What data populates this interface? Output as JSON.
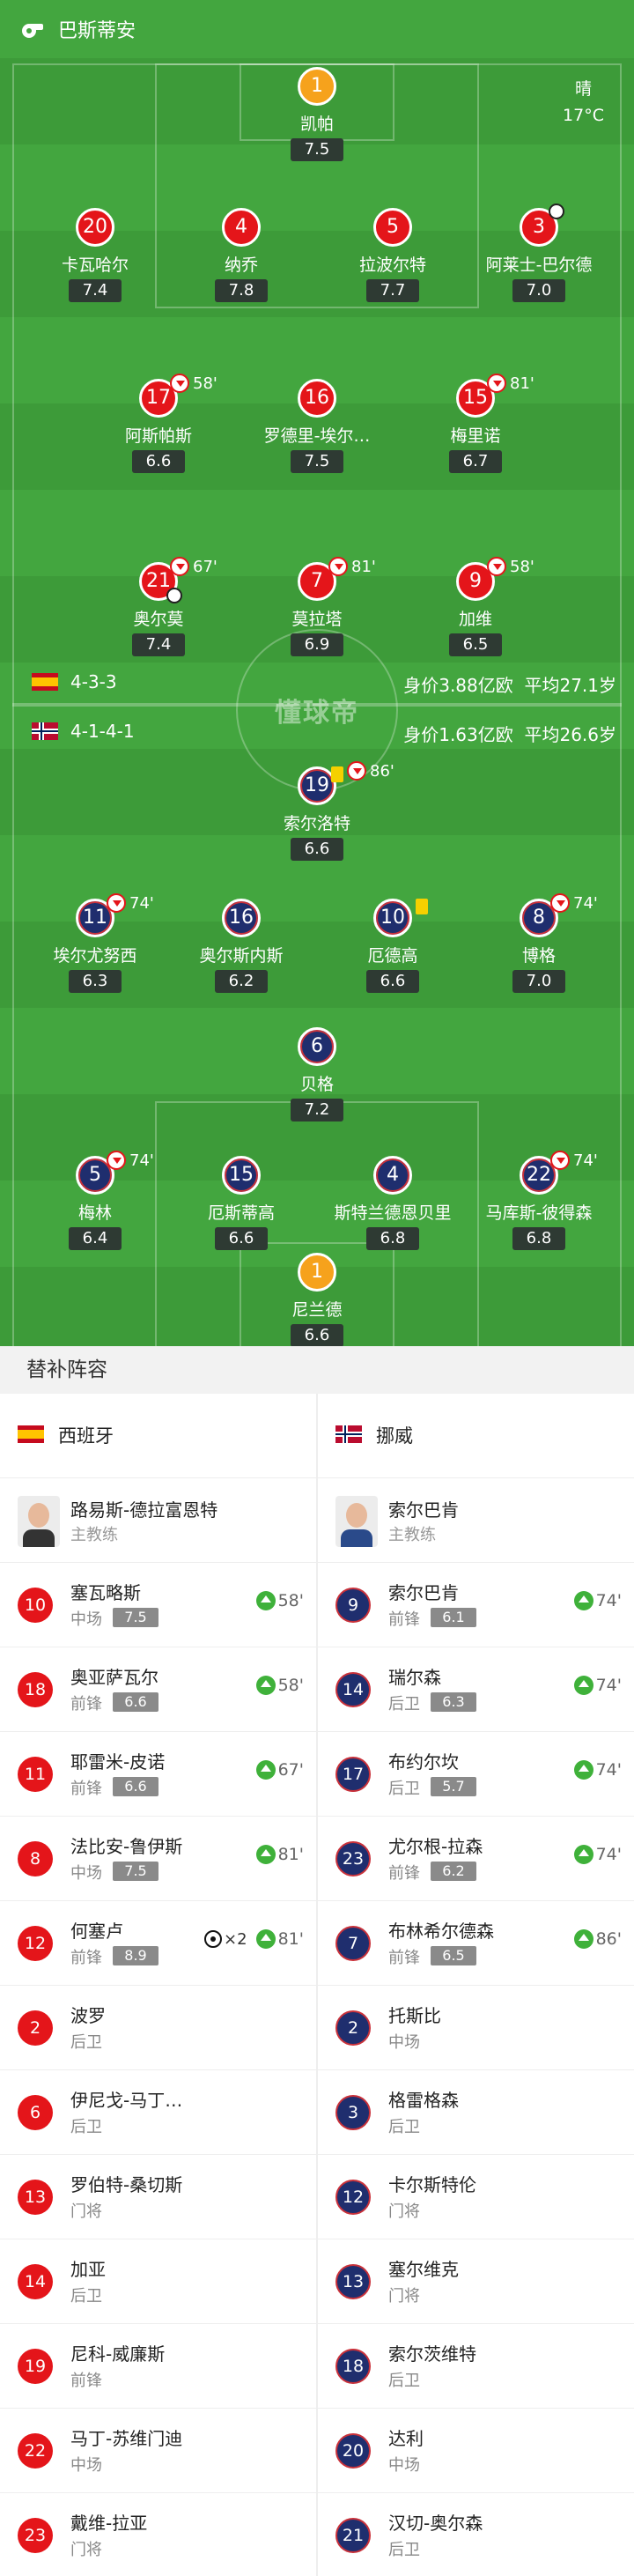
{
  "header": {
    "title": "巴斯蒂安",
    "icon": "whistle-icon"
  },
  "weather": {
    "condition": "晴",
    "temp": "17°C"
  },
  "colors": {
    "pitch": "#43a63f",
    "spain": "#e4151a",
    "norway": "#1f2e6e",
    "sub_in": "#3fb13a"
  },
  "spain": {
    "formation": "4-3-3",
    "value": "身价3.88亿欧",
    "avg_age": "平均27.1岁",
    "players": [
      {
        "num": "1",
        "name": "凯帕",
        "rating": "7.5"
      },
      {
        "num": "20",
        "name": "卡瓦哈尔",
        "rating": "7.4"
      },
      {
        "num": "4",
        "name": "纳乔",
        "rating": "7.8"
      },
      {
        "num": "5",
        "name": "拉波尔特",
        "rating": "7.7"
      },
      {
        "num": "3",
        "name": "阿莱士-巴尔德",
        "rating": "7.0"
      },
      {
        "num": "17",
        "name": "阿斯帕斯",
        "rating": "6.6",
        "sub": "58'"
      },
      {
        "num": "16",
        "name": "罗德里-埃尔…",
        "rating": "7.5"
      },
      {
        "num": "15",
        "name": "梅里诺",
        "rating": "6.7",
        "sub": "81'"
      },
      {
        "num": "21",
        "name": "奥尔莫",
        "rating": "7.4",
        "sub": "67'"
      },
      {
        "num": "7",
        "name": "莫拉塔",
        "rating": "6.9",
        "sub": "81'"
      },
      {
        "num": "9",
        "name": "加维",
        "rating": "6.5",
        "sub": "58'"
      }
    ]
  },
  "norway": {
    "formation": "4-1-4-1",
    "value": "身价1.63亿欧",
    "avg_age": "平均26.6岁",
    "players": [
      {
        "num": "19",
        "name": "索尔洛特",
        "rating": "6.6",
        "sub": "86'"
      },
      {
        "num": "11",
        "name": "埃尔尤努西",
        "rating": "6.3",
        "sub": "74'"
      },
      {
        "num": "16",
        "name": "奥尔斯内斯",
        "rating": "6.2"
      },
      {
        "num": "10",
        "name": "厄德高",
        "rating": "6.6"
      },
      {
        "num": "8",
        "name": "博格",
        "rating": "7.0",
        "sub": "74'"
      },
      {
        "num": "6",
        "name": "贝格",
        "rating": "7.2"
      },
      {
        "num": "5",
        "name": "梅林",
        "rating": "6.4",
        "sub": "74'"
      },
      {
        "num": "15",
        "name": "厄斯蒂高",
        "rating": "6.6"
      },
      {
        "num": "4",
        "name": "斯特兰德恩贝里",
        "rating": "6.8"
      },
      {
        "num": "22",
        "name": "马库斯-彼得森",
        "rating": "6.8",
        "sub": "74'"
      },
      {
        "num": "1",
        "name": "尼兰德",
        "rating": "6.6"
      }
    ]
  },
  "watermark": "懂球帝",
  "subs": {
    "heading": "替补阵容",
    "left": {
      "team": "西班牙",
      "coach": {
        "name": "路易斯-德拉富恩特",
        "role": "主教练"
      },
      "players": [
        {
          "num": "10",
          "name": "塞瓦略斯",
          "pos": "中场",
          "rating": "7.5",
          "in": "58'"
        },
        {
          "num": "18",
          "name": "奥亚萨瓦尔",
          "pos": "前锋",
          "rating": "6.6",
          "in": "58'"
        },
        {
          "num": "11",
          "name": "耶雷米-皮诺",
          "pos": "前锋",
          "rating": "6.6",
          "in": "67'"
        },
        {
          "num": "8",
          "name": "法比安-鲁伊斯",
          "pos": "中场",
          "rating": "7.5",
          "in": "81'"
        },
        {
          "num": "12",
          "name": "何塞卢",
          "pos": "前锋",
          "rating": "8.9",
          "in": "81'",
          "goals": "×2"
        },
        {
          "num": "2",
          "name": "波罗",
          "pos": "后卫"
        },
        {
          "num": "6",
          "name": "伊尼戈-马丁…",
          "pos": "后卫"
        },
        {
          "num": "13",
          "name": "罗伯特-桑切斯",
          "pos": "门将"
        },
        {
          "num": "14",
          "name": "加亚",
          "pos": "后卫"
        },
        {
          "num": "19",
          "name": "尼科-威廉斯",
          "pos": "前锋"
        },
        {
          "num": "22",
          "name": "马丁-苏维门迪",
          "pos": "中场"
        },
        {
          "num": "23",
          "name": "戴维-拉亚",
          "pos": "门将"
        }
      ]
    },
    "right": {
      "team": "挪威",
      "coach": {
        "name": "索尔巴肯",
        "role": "主教练"
      },
      "players": [
        {
          "num": "9",
          "name": "索尔巴肯",
          "pos": "前锋",
          "rating": "6.1",
          "in": "74'"
        },
        {
          "num": "14",
          "name": "瑞尔森",
          "pos": "后卫",
          "rating": "6.3",
          "in": "74'"
        },
        {
          "num": "17",
          "name": "布约尔坎",
          "pos": "后卫",
          "rating": "5.7",
          "in": "74'"
        },
        {
          "num": "23",
          "name": "尤尔根-拉森",
          "pos": "前锋",
          "rating": "6.2",
          "in": "74'"
        },
        {
          "num": "7",
          "name": "布林希尔德森",
          "pos": "前锋",
          "rating": "6.5",
          "in": "86'"
        },
        {
          "num": "2",
          "name": "托斯比",
          "pos": "中场"
        },
        {
          "num": "3",
          "name": "格雷格森",
          "pos": "后卫"
        },
        {
          "num": "12",
          "name": "卡尔斯特伦",
          "pos": "门将"
        },
        {
          "num": "13",
          "name": "塞尔维克",
          "pos": "门将"
        },
        {
          "num": "18",
          "name": "索尔茨维特",
          "pos": "后卫"
        },
        {
          "num": "20",
          "name": "达利",
          "pos": "中场"
        },
        {
          "num": "21",
          "name": "汉切-奥尔森",
          "pos": "后卫"
        }
      ]
    }
  }
}
